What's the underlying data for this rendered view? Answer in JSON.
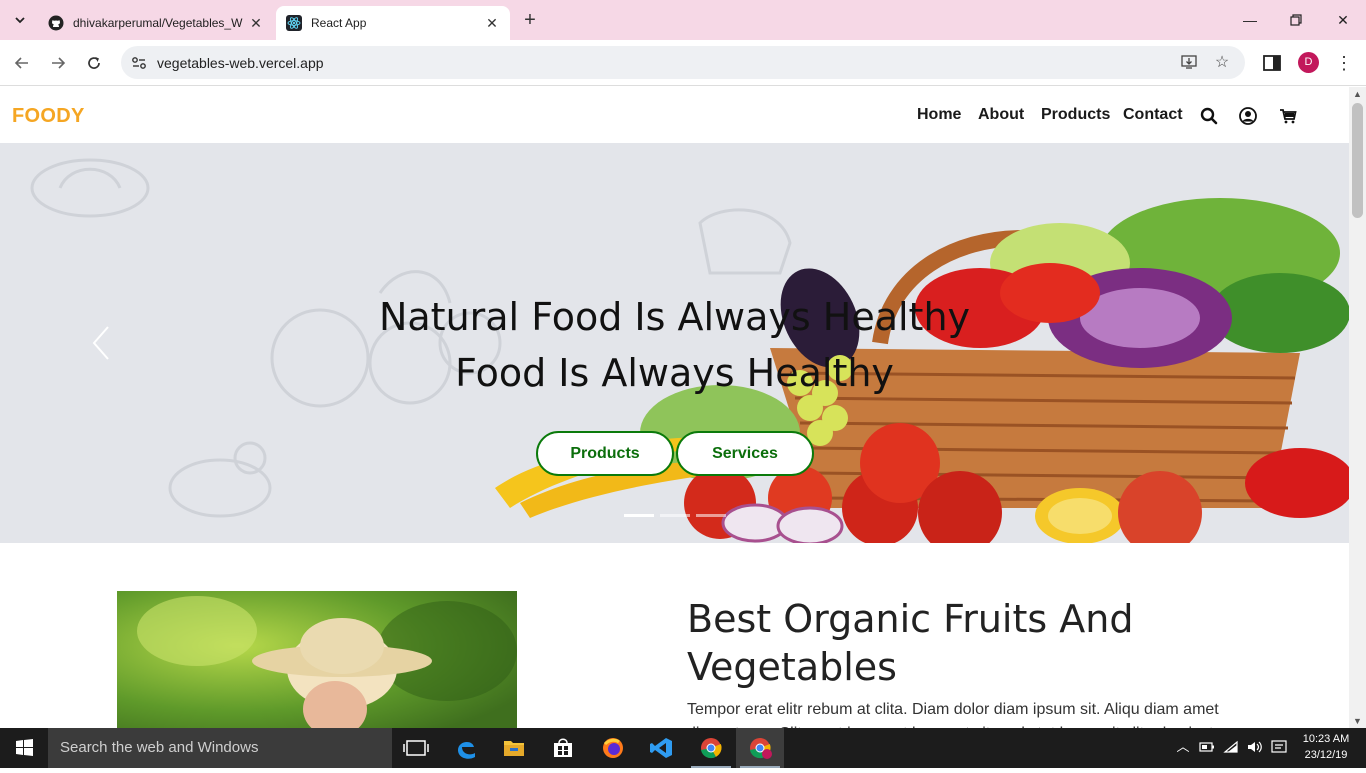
{
  "browser": {
    "tabs": [
      {
        "title": "dhivakarperumal/Vegetables_W",
        "icon": "github-icon",
        "active": false
      },
      {
        "title": "React App",
        "icon": "react-icon",
        "active": true
      }
    ],
    "url": "vegetables-web.vercel.app",
    "profile_initial": "D"
  },
  "site": {
    "logo": "FOODY",
    "nav": [
      "Home",
      "About",
      "Products",
      "Contact"
    ],
    "nav_icons": [
      "search-icon",
      "user-icon",
      "cart-icon"
    ],
    "hero": {
      "line1": "Natural Food Is Always Healthy",
      "line2": "Food Is Always Healthy",
      "buttons": [
        "Products",
        "Services"
      ],
      "slides": 3,
      "active_slide": 1
    },
    "about": {
      "title": "Best Organic Fruits And Vegetables",
      "text": "Tempor erat elitr rebum at clita. Diam dolor diam ipsum sit. Aliqu diam amet diam et eos. Clita erat ipsum et lorem et sit, sed stet lorem sit clita duo justo"
    }
  },
  "taskbar": {
    "search_placeholder": "Search the web and Windows",
    "time": "10:23 AM",
    "date": "23/12/19"
  },
  "colors": {
    "tabstrip": "#f6d8e6",
    "logo": "#f5a623",
    "hero_button": "#0b7a0b",
    "hero_bg": "#e3e5ea"
  }
}
